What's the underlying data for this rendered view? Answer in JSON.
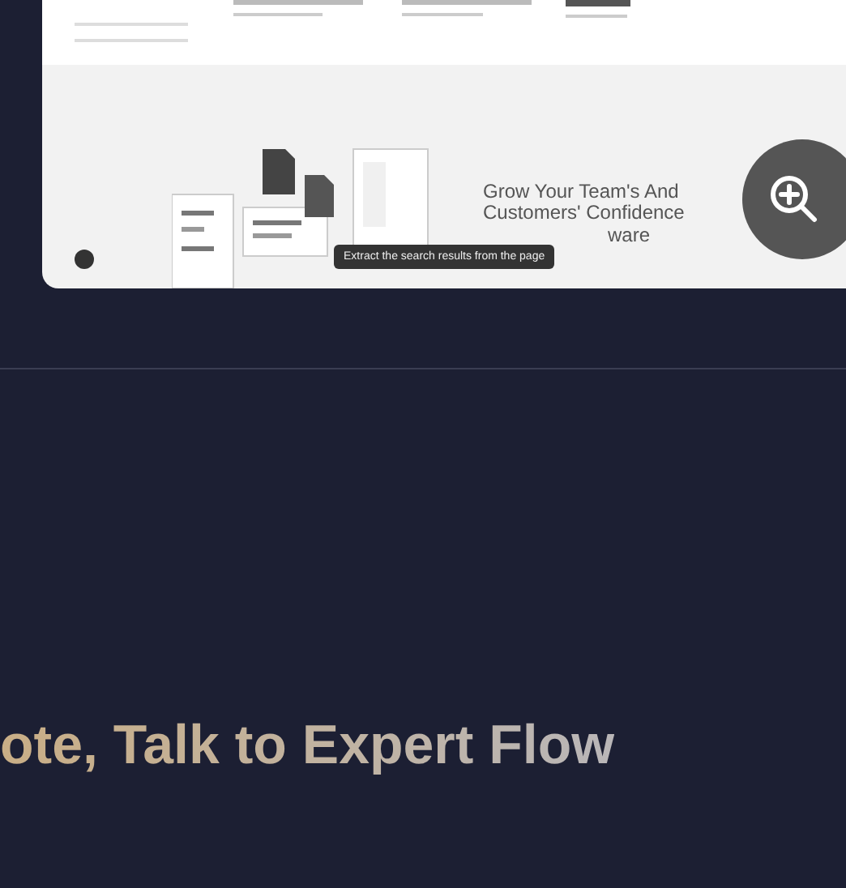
{
  "preview": {
    "headline": [
      "Grow Your Team's And",
      "Customers' Confidence",
      "ware"
    ],
    "tooltip": "Extract the search results from the page"
  },
  "heading": "ote, Talk to Expert Flow"
}
